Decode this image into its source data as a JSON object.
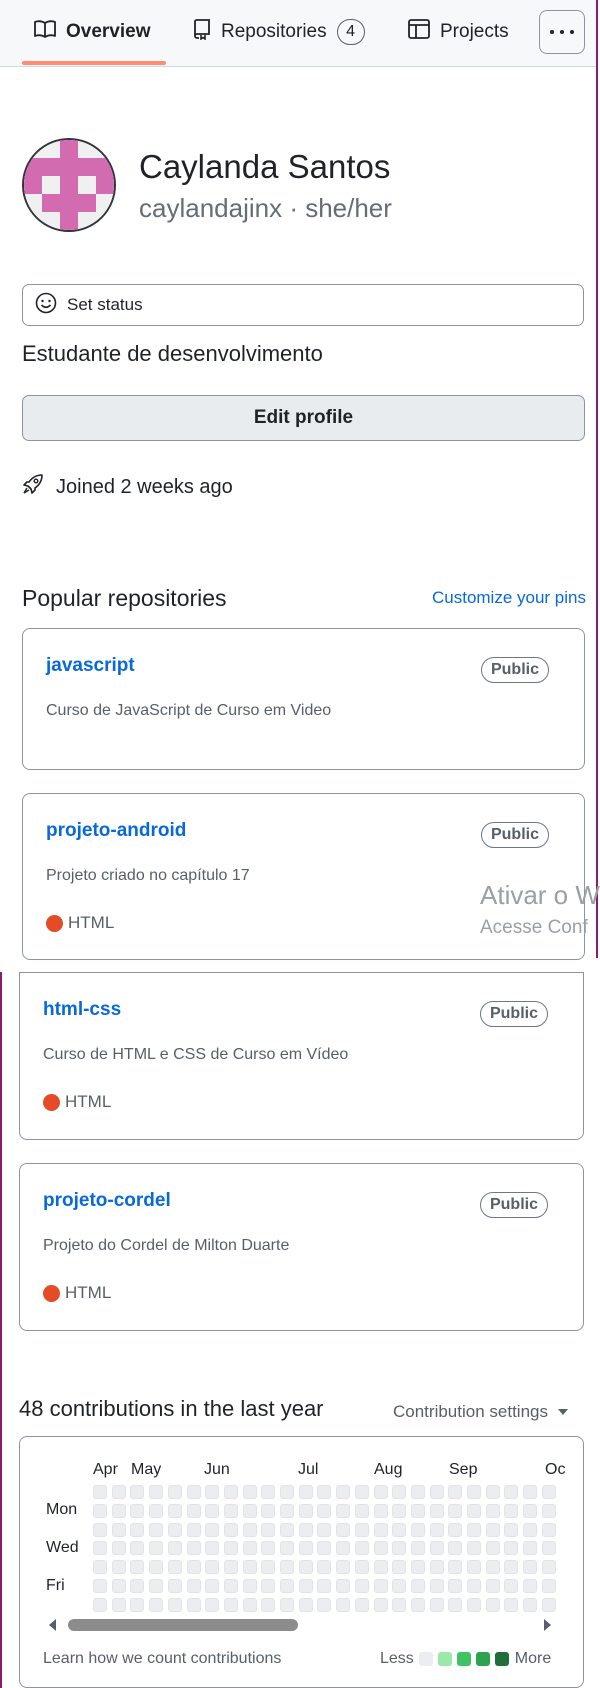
{
  "tabs": [
    {
      "label": "Overview",
      "icon": "book-icon",
      "active": true
    },
    {
      "label": "Repositories",
      "icon": "repo-icon",
      "count": "4"
    },
    {
      "label": "Projects",
      "icon": "table-icon"
    }
  ],
  "profile": {
    "name": "Caylanda Santos",
    "login_line": "caylandajinx · she/her",
    "status_label": "Set status",
    "bio": "Estudante de desenvolvimento",
    "edit_label": "Edit profile",
    "joined": "Joined 2 weeks ago"
  },
  "popular": {
    "title": "Popular repositories",
    "customize": "Customize your pins",
    "repos": [
      {
        "name": "javascript",
        "badge": "Public",
        "description": "Curso de JavaScript de Curso em Video",
        "language": ""
      },
      {
        "name": "projeto-android",
        "badge": "Public",
        "description": "Projeto criado no capítulo 17",
        "language": "HTML"
      },
      {
        "name": "html-css",
        "badge": "Public",
        "description": "Curso de HTML e CSS de Curso em Vídeo",
        "language": "HTML"
      },
      {
        "name": "projeto-cordel",
        "badge": "Public",
        "description": "Projeto do Cordel de Milton Duarte",
        "language": "HTML"
      }
    ],
    "language_color": "#e34c26"
  },
  "watermark": {
    "line1": "Ativar o W",
    "line2": "Acesse Conf"
  },
  "contributions": {
    "title": "48 contributions in the last year",
    "settings": "Contribution settings",
    "months": [
      "Apr",
      "May",
      "Jun",
      "Jul",
      "Aug",
      "Sep",
      "Oc"
    ],
    "days": [
      "Mon",
      "Wed",
      "Fri"
    ],
    "learn": "Learn how we count contributions",
    "legend_less": "Less",
    "legend_more": "More",
    "legend_colors": [
      "#ebedf0",
      "#9be9a8",
      "#40c463",
      "#30a14e",
      "#216e39"
    ]
  }
}
